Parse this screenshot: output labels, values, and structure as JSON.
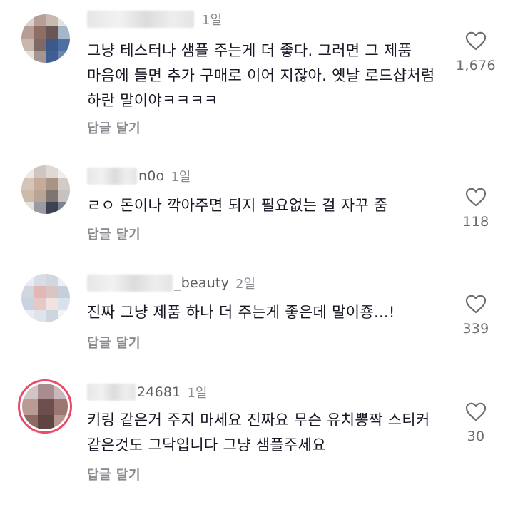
{
  "comments": [
    {
      "username_visible": "",
      "time": "1일",
      "text": "그냥 테스터나 샘플 주는게 더 좋다. 그러면 그 제품 마음에 들면 추가 구매로 이어 지잖아. 옛날 로드샵처럼 하란 말이야ㅋㅋㅋㅋ",
      "reply_label": "답글 달기",
      "likes": "1,676"
    },
    {
      "username_visible": "n0o",
      "time": "1일",
      "text": "ㄹㅇ 돈이나 깍아주면 되지 필요없는 걸 자꾸 줌",
      "reply_label": "답글 달기",
      "likes": "118"
    },
    {
      "username_visible": "_beauty",
      "time": "2일",
      "text": "진짜 그냥 제품 하나 더 주는게 좋은데 말이죵...!",
      "reply_label": "답글 달기",
      "likes": "339"
    },
    {
      "username_visible": "24681",
      "time": "1일",
      "text": "키링 같은거 주지 마세요 진짜요 무슨 유치뽕짝 스티커 같은것도 그닥입니다 그냥 샘플주세요",
      "reply_label": "답글 달기",
      "likes": "30"
    }
  ],
  "icons": {
    "like": "heart-outline-icon"
  },
  "colors": {
    "text_primary": "#161823",
    "text_secondary": "#8a8b91",
    "story_ring": "#e94b6a"
  }
}
